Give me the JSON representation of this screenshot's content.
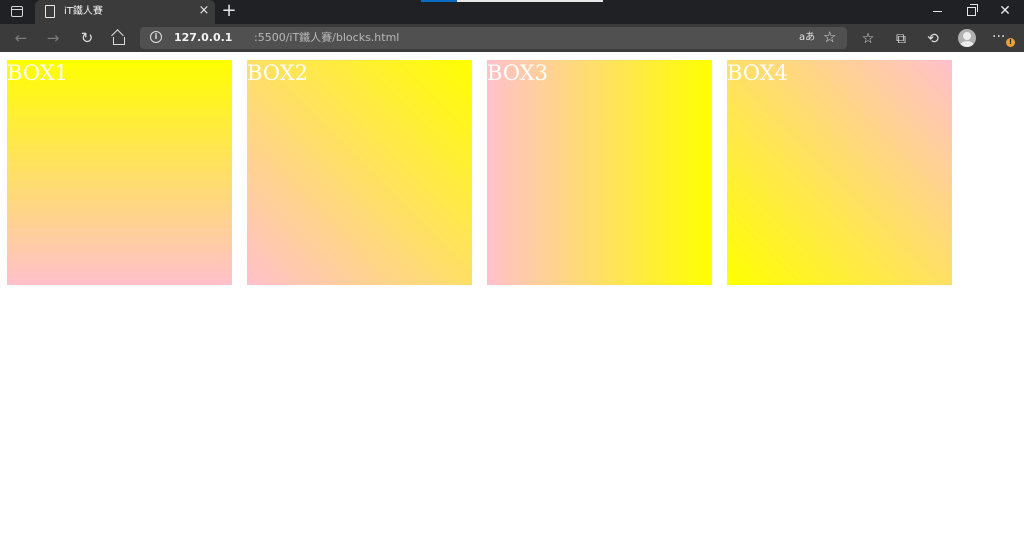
{
  "browser": {
    "tab": {
      "title": "iT鐵人賽",
      "close_glyph": "×"
    },
    "new_tab_glyph": "+",
    "window": {
      "close_glyph": "✕"
    },
    "nav": {
      "back_glyph": "←",
      "forward_glyph": "→",
      "refresh_glyph": "↻"
    },
    "address": {
      "info_glyph": "i",
      "host": "127.0.0.1",
      "rest": ":5500/iT鐵人賽/blocks.html",
      "read_aloud_glyph": "aあ",
      "favorite_add_glyph": "☆"
    },
    "toolbar": {
      "favorites_glyph": "☆",
      "collections_glyph": "⧉",
      "history_glyph": "⟲",
      "menu_glyph": "···",
      "badge_glyph": "!"
    }
  },
  "page": {
    "boxes": [
      {
        "label": "BOX1"
      },
      {
        "label": "BOX2"
      },
      {
        "label": "BOX3"
      },
      {
        "label": "BOX4"
      }
    ]
  },
  "colors": {
    "gradient_start": "#ffff00",
    "gradient_end": "#ffc0cb",
    "titlebar": "#202124",
    "toolbar": "#3b3b3b",
    "address_bar": "#505050",
    "loading_accent": "#0a6bc4",
    "badge": "#f0a030"
  }
}
